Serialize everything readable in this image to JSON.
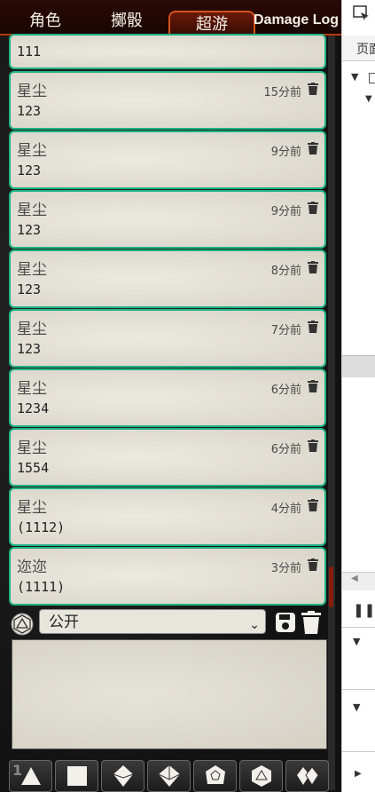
{
  "tabs": [
    "角色",
    "擲骰",
    "超游",
    "Damage Log"
  ],
  "messages": [
    {
      "sender": "",
      "text": "111",
      "time": ""
    },
    {
      "sender": "星尘",
      "text": "123",
      "time": "15分前"
    },
    {
      "sender": "星尘",
      "text": "123",
      "time": "9分前"
    },
    {
      "sender": "星尘",
      "text": "123",
      "time": "9分前"
    },
    {
      "sender": "星尘",
      "text": "123",
      "time": "8分前"
    },
    {
      "sender": "星尘",
      "text": "123",
      "time": "7分前"
    },
    {
      "sender": "星尘",
      "text": "1234",
      "time": "6分前"
    },
    {
      "sender": "星尘",
      "text": "1554",
      "time": "6分前"
    },
    {
      "sender": "星尘",
      "text": "(1112)",
      "time": "4分前"
    },
    {
      "sender": "迩迩",
      "text": "(1111)",
      "time": "3分前"
    }
  ],
  "controls": {
    "visibility": "公开"
  },
  "devtools": {
    "tab_label": "页面",
    "badge": "1"
  },
  "icons": {
    "trash": "trash-icon",
    "save": "save-icon",
    "d20": "d20-icon",
    "dice": [
      "d4-icon",
      "d6-icon",
      "d8-icon",
      "d10-icon",
      "d12-icon",
      "d20-icon",
      "d100-icon"
    ]
  },
  "colors": {
    "accent": "#1fb383",
    "tab_active": "#d5521a",
    "scroll_thumb": "#8a1c0c"
  }
}
